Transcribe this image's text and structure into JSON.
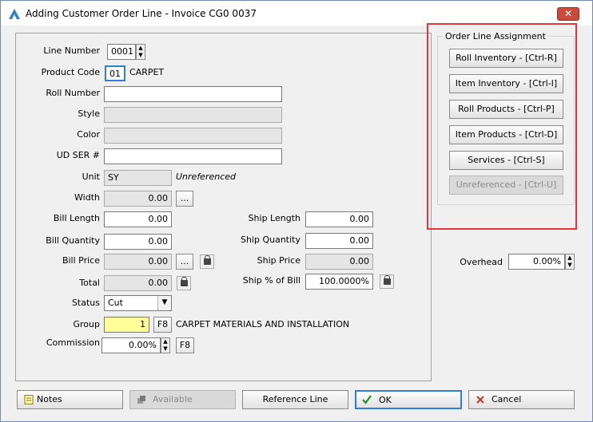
{
  "window": {
    "title": "Adding Customer Order Line - Invoice CG0 0037",
    "close_label": "✕"
  },
  "form": {
    "line_number": {
      "label": "Line Number",
      "value": "0001"
    },
    "product_code": {
      "label": "Product Code",
      "value": "01",
      "desc": "CARPET"
    },
    "roll_number": {
      "label": "Roll Number",
      "value": ""
    },
    "style": {
      "label": "Style",
      "value": ""
    },
    "color": {
      "label": "Color",
      "value": ""
    },
    "ud_ser": {
      "label": "UD SER #",
      "value": ""
    },
    "unit": {
      "label": "Unit",
      "value": "SY",
      "note": "Unreferenced"
    },
    "width": {
      "label": "Width",
      "value": "0.00",
      "btn": "..."
    },
    "bill_length": {
      "label": "Bill Length",
      "value": "0.00"
    },
    "bill_quantity": {
      "label": "Bill Quantity",
      "value": "0.00"
    },
    "bill_price": {
      "label": "Bill Price",
      "value": "0.00",
      "btn": "..."
    },
    "total": {
      "label": "Total",
      "value": "0.00"
    },
    "status": {
      "label": "Status",
      "value": "Cut"
    },
    "group": {
      "label": "Group",
      "value": "1",
      "btn": "F8",
      "desc": "CARPET MATERIALS AND INSTALLATION"
    },
    "commission": {
      "label": "Commission",
      "value": "0.00%",
      "btn": "F8"
    },
    "ship_length": {
      "label": "Ship Length",
      "value": "0.00"
    },
    "ship_quantity": {
      "label": "Ship Quantity",
      "value": "0.00"
    },
    "ship_price": {
      "label": "Ship Price",
      "value": "0.00"
    },
    "ship_pct": {
      "label": "Ship % of Bill",
      "value": "100.0000%"
    },
    "overhead": {
      "label": "Overhead",
      "value": "0.00%"
    }
  },
  "assignment": {
    "legend": "Order Line Assignment",
    "buttons": [
      "Roll Inventory - [Ctrl-R]",
      "Item Inventory - [Ctrl-I]",
      "Roll Products - [Ctrl-P]",
      "Item Products - [Ctrl-D]",
      "Services - [Ctrl-S]",
      "Unreferenced - [Ctrl-U]"
    ]
  },
  "bottom": {
    "notes": "Notes",
    "available": "Available",
    "reference_line": "Reference Line",
    "ok": "OK",
    "cancel": "Cancel"
  },
  "colors": {
    "accent": "#2f7fd6",
    "highlight": "#e5343a",
    "group_field": "#ffff9a"
  }
}
